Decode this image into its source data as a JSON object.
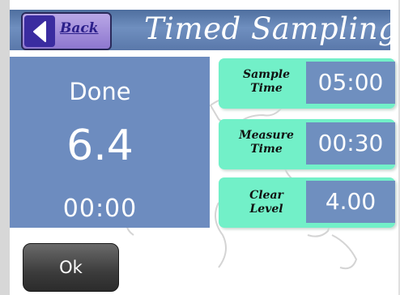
{
  "header": {
    "title": "Timed Sampling",
    "back_label": "Back"
  },
  "status": {
    "state": "Done",
    "reading": "6.4",
    "elapsed": "00:00"
  },
  "params": [
    {
      "label_line1": "Sample",
      "label_line2": "Time",
      "value": "05:00"
    },
    {
      "label_line1": "Measure",
      "label_line2": "Time",
      "value": "00:30"
    },
    {
      "label_line1": "Clear",
      "label_line2": "Level",
      "value": "4.00"
    }
  ],
  "footer": {
    "ok_label": "Ok"
  },
  "colors": {
    "panel": "#6d8cbf",
    "param_bg": "#72f0c8",
    "accent": "#3a2ca0"
  }
}
